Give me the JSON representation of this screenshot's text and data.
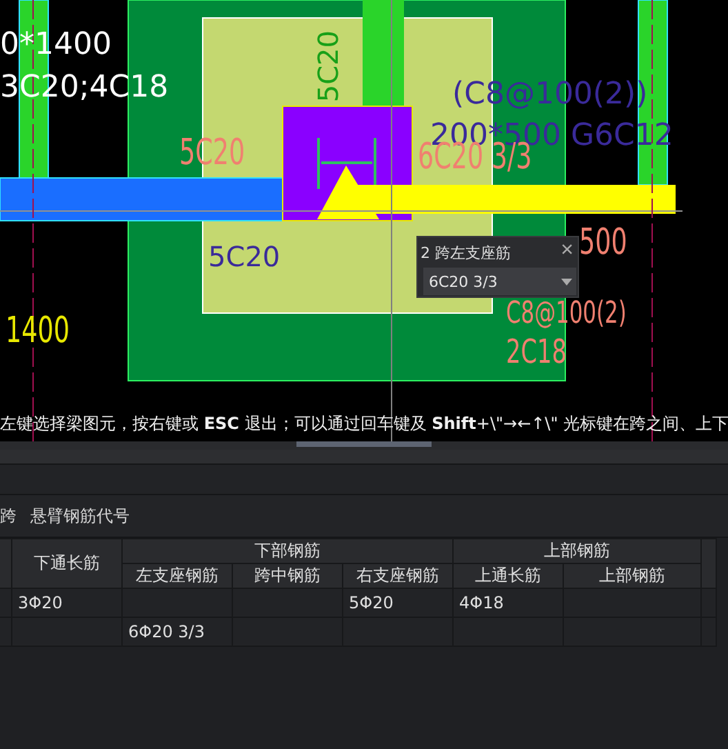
{
  "canvas": {
    "labels": [
      {
        "text": "0*1400",
        "color": "#ffffff",
        "kind": "plain"
      },
      {
        "text": "3C20;4C18",
        "color": "#ffffff",
        "kind": "plain"
      },
      {
        "text": "5C20",
        "color": "#18a018",
        "kind": "vertical"
      },
      {
        "text": "(C8@100(2))",
        "color": "#3a2a9a",
        "kind": "plain"
      },
      {
        "text": "200*500 G6C12",
        "color": "#3a2a9a",
        "kind": "plain"
      },
      {
        "text": "5C20",
        "color": "#f08070",
        "kind": "thin"
      },
      {
        "text": "6C20 3/3",
        "color": "#f08070",
        "kind": "thin"
      },
      {
        "text": "5C20",
        "color": "#3a2a9a",
        "kind": "plain"
      },
      {
        "text": "500",
        "color": "#f08070",
        "kind": "thin"
      },
      {
        "text": "C8@100(2)",
        "color": "#f08070",
        "kind": "thin"
      },
      {
        "text": "2C18",
        "color": "#f08070",
        "kind": "thin"
      },
      {
        "text": "1400",
        "color": "#e8e800",
        "kind": "thin"
      }
    ]
  },
  "popup": {
    "title": "2 跨左支座筋",
    "close": "×",
    "value": "6C20 3/3"
  },
  "status": "左键选择梁图元，按右键或 **ESC** 退出；可以通过回车键及 **Shift**+\\\"→←↑\\\" 光标键在跨之间、上下",
  "toolbar": [
    "跨",
    "悬臂钢筋代号"
  ],
  "table": {
    "column_1": "下通长筋",
    "groups": [
      {
        "label": "下部钢筋",
        "columns": [
          "左支座钢筋",
          "跨中钢筋",
          "右支座钢筋"
        ]
      },
      {
        "label": "上部钢筋",
        "columns": [
          "上通长筋",
          "上部钢筋"
        ]
      }
    ],
    "rows": [
      [
        "3Φ20",
        "",
        "",
        "5Φ20",
        "4Φ18",
        ""
      ],
      [
        "",
        "6Φ20 3/3",
        "",
        "",
        "",
        ""
      ]
    ]
  }
}
